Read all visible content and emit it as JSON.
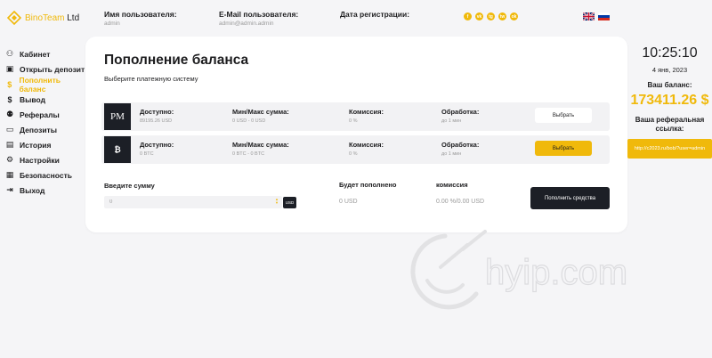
{
  "brand": {
    "name": "BinoTeam",
    "suffix": " Ltd"
  },
  "header": {
    "username_label": "Имя пользователя:",
    "username_value": "admin",
    "email_label": "E-Mail пользователя:",
    "email_value": "admin@admin.admin",
    "regdate_label": "Дата регистрации:",
    "regdate_value": ""
  },
  "socials": [
    "f",
    "vk",
    "tg",
    "tw",
    "ok"
  ],
  "sidebar": {
    "items": [
      {
        "label": "Кабинет",
        "icon": "user-icon",
        "glyph": "⚇",
        "active": false
      },
      {
        "label": "Открыть депозит",
        "icon": "briefcase-icon",
        "glyph": "▣",
        "active": false
      },
      {
        "label": "Пополнить баланс",
        "icon": "dollar-icon",
        "glyph": "$",
        "active": true
      },
      {
        "label": "Вывод",
        "icon": "dollar-out-icon",
        "glyph": "$",
        "active": false
      },
      {
        "label": "Рефералы",
        "icon": "users-icon",
        "glyph": "⚉",
        "active": false
      },
      {
        "label": "Депозиты",
        "icon": "monitor-icon",
        "glyph": "▭",
        "active": false
      },
      {
        "label": "История",
        "icon": "document-icon",
        "glyph": "▤",
        "active": false
      },
      {
        "label": "Настройки",
        "icon": "gear-icon",
        "glyph": "⚙",
        "active": false
      },
      {
        "label": "Безопасность",
        "icon": "lock-icon",
        "glyph": "▦",
        "active": false
      },
      {
        "label": "Выход",
        "icon": "logout-icon",
        "glyph": "⇥",
        "active": false
      }
    ]
  },
  "main": {
    "title": "Пополнение баланса",
    "subtitle": "Выберите платежную систему",
    "payments": [
      {
        "logo": "PM",
        "available_label": "Доступно:",
        "available_value": "89195.26 USD",
        "minmax_label": "Мин/Макс сумма:",
        "minmax_value": "0 USD - 0 USD",
        "fee_label": "Комиссия:",
        "fee_value": "0 %",
        "processing_label": "Обработка:",
        "processing_value": "до 1 мин",
        "button": "Выбрать"
      },
      {
        "logo": "₿",
        "available_label": "Доступно:",
        "available_value": "0 BTC",
        "minmax_label": "Мин/Макс сумма:",
        "minmax_value": "0 BTC - 0 BTC",
        "fee_label": "Комиссия:",
        "fee_value": "0 %",
        "processing_label": "Обработка:",
        "processing_value": "до 1 мин",
        "button": "Выбрать"
      }
    ],
    "amount_label": "Введите сумму",
    "amount_value": "0",
    "currency": "USD",
    "credited_label": "Будет пополнено",
    "credited_value": "0 USD",
    "commission_label": "комиссия",
    "commission_value": "0.00 %/0.00 USD",
    "submit": "Пополнить средства"
  },
  "right": {
    "time": "10:25:10",
    "date": "4 янв, 2023",
    "balance_label": "Ваш баланс:",
    "balance_value": "173411.26 $",
    "ref_label": "Ваша реферальная ссылка:",
    "ref_link": "http://c2023.ru/bob/?user=admin"
  },
  "watermark": "hyip.com",
  "colors": {
    "accent": "#f0b90b",
    "dark": "#1c1f26",
    "bg": "#f5f5f7"
  }
}
